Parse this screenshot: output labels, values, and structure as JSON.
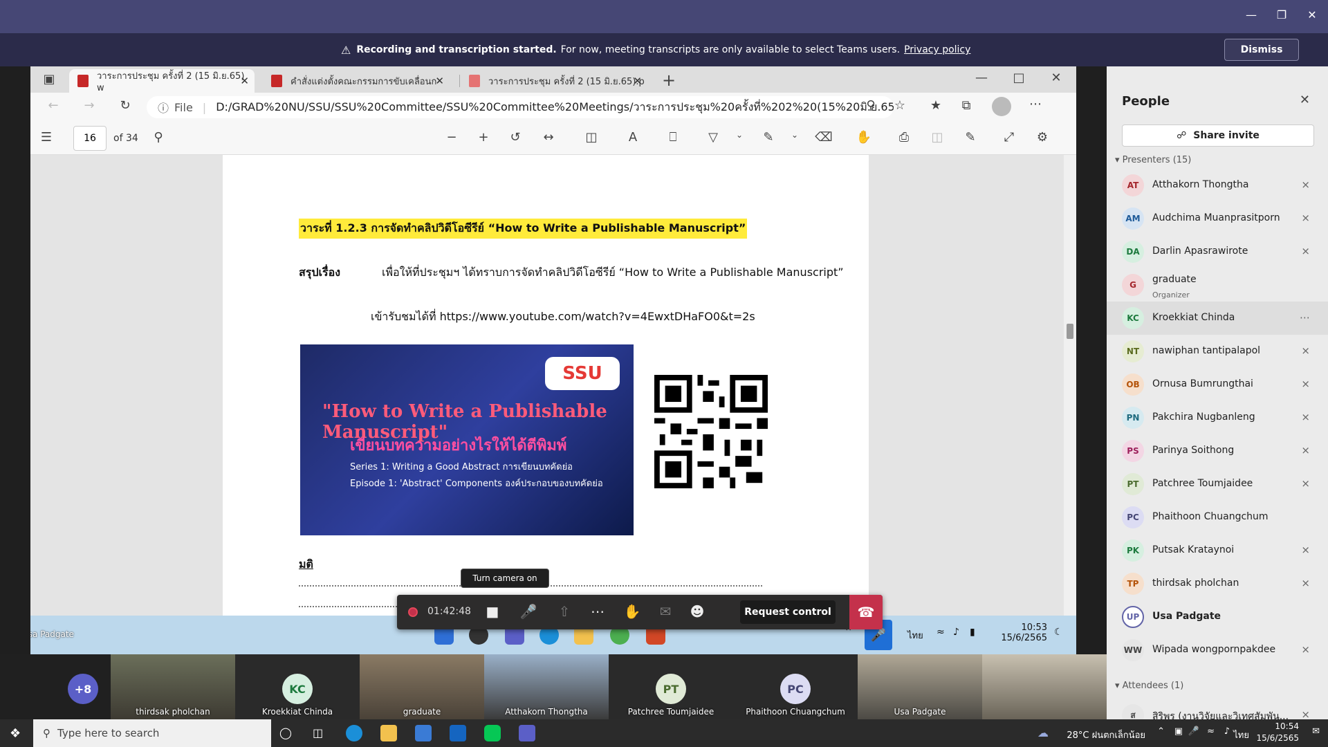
{
  "banner": {
    "bold": "Recording and transcription started.",
    "text": "For now, meeting transcripts are only available to select Teams users.",
    "link": "Privacy policy",
    "dismiss": "Dismiss"
  },
  "browser": {
    "tabs": [
      {
        "label": "วาระการประชุม ครั้งที่ 2 (15 มิ.ย.65) w"
      },
      {
        "label": "คำสั่งแต่งตั้งคณะกรรมการขับเคลื่อนก"
      },
      {
        "label": "วาระการประชุม ครั้งที่ 2 (15 มิ.ย.65).p"
      }
    ],
    "address_prefix": "File",
    "url": "D:/GRAD%20NU/SSU/SSU%20Committee/SSU%20Committee%20Meetings/วาระการประชุม%20ครั้งที่%202%20(15%20มิ.ย.65)%..."
  },
  "pdf": {
    "page": "16",
    "of": "of 34"
  },
  "doc": {
    "agenda": "วาระที่ 1.2.3    การจัดทำคลิปวิดีโอซีรีย์ “How to Write a Publishable Manuscript”",
    "summary_label": "สรุปเรื่อง",
    "summary": "เพื่อให้ที่ประชุมฯ ได้ทราบการจัดทำคลิปวิดีโอซีรีย์ “How to Write a Publishable Manuscript”",
    "watch": "เข้ารับชมได้ที่ https://www.youtube.com/watch?v=4EwxtDHaFO0&t=2s",
    "promo": {
      "logo": "SSU",
      "title": "\"How to Write a Publishable Manuscript\"",
      "thai": "เขียนบทความอย่างไรให้ได้ตีพิมพ์",
      "series": "Series 1: Writing a Good Abstract การเขียนบทคัดย่อ",
      "episode": "Episode 1: 'Abstract' Components องค์ประกอบของบทคัดย่อ"
    },
    "resolution_label": "มติ"
  },
  "meeting": {
    "tooltip": "Turn camera on",
    "timer": "01:42:48",
    "request_control": "Request control"
  },
  "inner_taskbar": {
    "user_label": "Usa Padgate",
    "lang": "ไทย",
    "time": "10:53",
    "date": "15/6/2565"
  },
  "people": {
    "title": "People",
    "share_invite": "Share invite",
    "presenters_header": "Presenters (15)",
    "attendees_header": "Attendees (1)",
    "presenters": [
      {
        "initials": "AT",
        "name": "Atthakorn Thongtha",
        "role": "",
        "color": "#f3d6d8",
        "tc": "#a4262c"
      },
      {
        "initials": "AM",
        "name": "Audchima Muanprasitporn",
        "role": "",
        "color": "#d6e4f3",
        "tc": "#1f5b99"
      },
      {
        "initials": "DA",
        "name": "Darlin Apasrawirote",
        "role": "",
        "color": "#d6efe0",
        "tc": "#1d7a3e"
      },
      {
        "initials": "G",
        "name": "graduate",
        "role": "Organizer",
        "color": "#f3d6d8",
        "tc": "#a4262c"
      },
      {
        "initials": "KC",
        "name": "Kroekkiat Chinda",
        "role": "",
        "color": "#d6efe0",
        "tc": "#1d7a3e"
      },
      {
        "initials": "NT",
        "name": "nawiphan tantipalapol",
        "role": "",
        "color": "#e6ecd2",
        "tc": "#5a6b1e"
      },
      {
        "initials": "OB",
        "name": "Ornusa Bumrungthai",
        "role": "",
        "color": "#f6dfcc",
        "tc": "#b45309"
      },
      {
        "initials": "PN",
        "name": "Pakchira Nugbanleng",
        "role": "",
        "color": "#d6eaf0",
        "tc": "#1f6b7f"
      },
      {
        "initials": "PS",
        "name": "Parinya Soithong",
        "role": "",
        "color": "#f3d6e4",
        "tc": "#9c1f5b"
      },
      {
        "initials": "PT",
        "name": "Patchree Toumjaidee",
        "role": "",
        "color": "#e0ead6",
        "tc": "#4a6b2e"
      },
      {
        "initials": "PC",
        "name": "Phaithoon Chuangchum",
        "role": "",
        "color": "#dcdcf3",
        "tc": "#464775"
      },
      {
        "initials": "PK",
        "name": "Putsak Krataynoi",
        "role": "",
        "color": "#d6efe0",
        "tc": "#1d7a3e"
      },
      {
        "initials": "TP",
        "name": "thirdsak pholchan",
        "role": "",
        "color": "#f6dfcc",
        "tc": "#b45309"
      },
      {
        "initials": "UP",
        "name": "Usa Padgate",
        "role": "",
        "color": "#fff",
        "tc": "#6264a7"
      },
      {
        "initials": "WW",
        "name": "Wipada wongpornpakdee",
        "role": "",
        "color": "#e6e6e6",
        "tc": "#444"
      }
    ],
    "attendees": [
      {
        "initials": "ส",
        "name": "สิริพร (งานวิจัยและวิเทศสัมพัน..."
      }
    ]
  },
  "gallery": [
    {
      "label": "+8"
    },
    {
      "label": "thirdsak pholchan"
    },
    {
      "label": "Kroekkiat Chinda",
      "initials": "KC"
    },
    {
      "label": "graduate"
    },
    {
      "label": "Atthakorn Thongtha"
    },
    {
      "label": "Patchree Toumjaidee",
      "initials": "PT"
    },
    {
      "label": "Phaithoon Chuangchum",
      "initials": "PC"
    },
    {
      "label": "Usa Padgate"
    },
    {
      "label": ""
    }
  ],
  "taskbar": {
    "search": "Type here to search",
    "weather": "28°C ฝนตกเล็กน้อย",
    "lang": "ไทย",
    "time": "10:54",
    "date": "15/6/2565"
  }
}
